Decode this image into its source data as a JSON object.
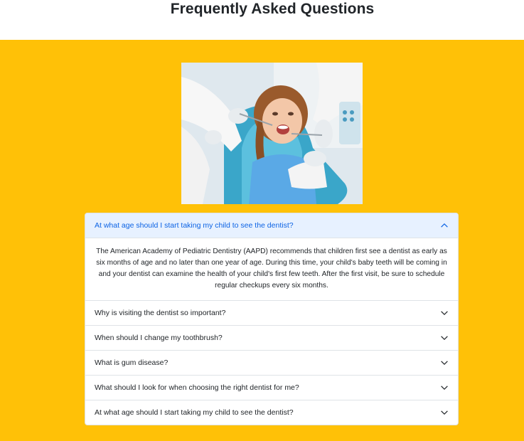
{
  "page": {
    "title": "Frequently Asked Questions"
  },
  "colors": {
    "section_background": "#ffc107",
    "accordion_active_bg": "#e7f1ff",
    "accordion_active_text": "#0c63e4",
    "border": "#dfe3e7"
  },
  "hero_image": {
    "icon": "dental-checkup-photo"
  },
  "faq": {
    "items": [
      {
        "question": "At what age should I start taking my child to see the dentist?",
        "answer": "The American Academy of Pediatric Dentistry (AAPD) recommends that children first see a dentist as early as six months of age and no later than one year of age. During this time, your child's baby teeth will be coming in and your dentist can examine the health of your child's first few teeth. After the first visit, be sure to schedule regular checkups every six months.",
        "expanded": true
      },
      {
        "question": "Why is visiting the dentist so important?",
        "expanded": false
      },
      {
        "question": "When should I change my toothbrush?",
        "expanded": false
      },
      {
        "question": "What is gum disease?",
        "expanded": false
      },
      {
        "question": "What should I look for when choosing the right dentist for me?",
        "expanded": false
      },
      {
        "question": "At what age should I start taking my child to see the dentist?",
        "expanded": false
      }
    ]
  }
}
